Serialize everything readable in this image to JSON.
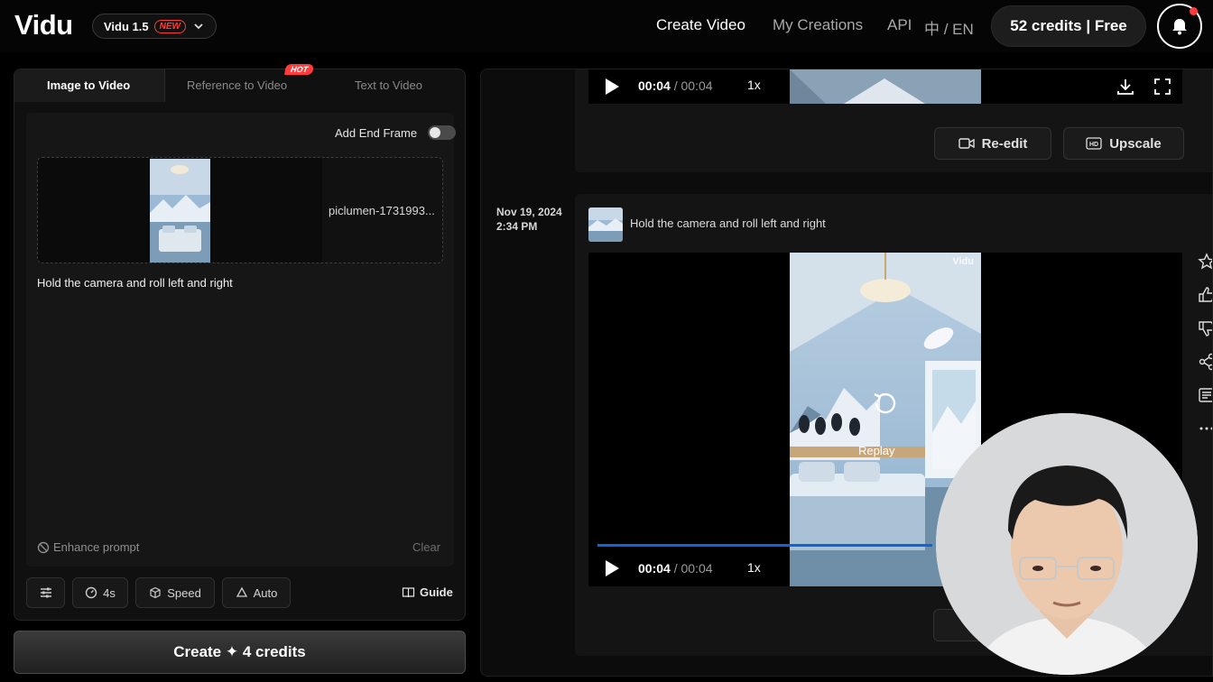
{
  "header": {
    "logo": "Vidu",
    "model": {
      "name": "Vidu 1.5",
      "badge": "NEW"
    },
    "nav": {
      "create_video": "Create Video",
      "my_creations": "My Creations",
      "api": "API",
      "language": "中 / EN"
    },
    "credits": "52 credits | Free",
    "bell_icon": "bell-icon"
  },
  "left_panel": {
    "tabs": [
      {
        "label": "Image to Video",
        "active": true
      },
      {
        "label": "Reference to Video",
        "badge": "HOT"
      },
      {
        "label": "Text to Video"
      }
    ],
    "add_end_frame": {
      "label": "Add End Frame",
      "enabled": false
    },
    "upload": {
      "file_name": "piclumen-1731993..."
    },
    "prompt": "Hold the camera and roll left and right",
    "enhance_prompt": "Enhance prompt",
    "clear": "Clear",
    "options": {
      "duration": "4s",
      "speed": "Speed",
      "auto": "Auto",
      "guide": "Guide"
    },
    "create_button": "Create ✦ 4 credits"
  },
  "results": {
    "previous": {
      "time_current": "00:04",
      "time_sep": " / ",
      "time_total": "00:04",
      "speed": "1x",
      "reedit": "Re-edit",
      "upscale": "Upscale"
    },
    "current": {
      "date": "Nov 19, 2024",
      "time": "2:34 PM",
      "prompt": "Hold the camera and roll left and right",
      "watermark": "Vidu",
      "replay": "Replay",
      "time_current": "00:04",
      "time_sep": " / ",
      "time_total": "00:04",
      "speed": "1x",
      "progress": 0.58
    },
    "side_icons": [
      "star-icon",
      "thumbs-up-icon",
      "thumbs-down-icon",
      "share-icon",
      "list-icon",
      "more-icon"
    ]
  },
  "colors": {
    "accent_blue": "#1463d6",
    "badge_red": "#ff3b3b",
    "panel": "#101010"
  }
}
